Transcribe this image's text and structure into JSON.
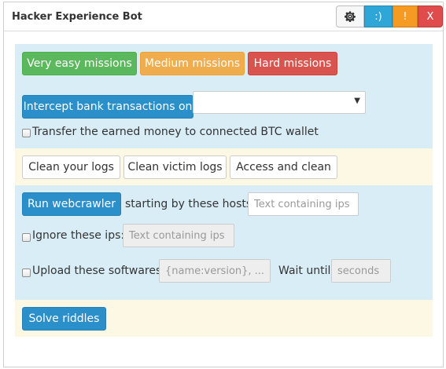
{
  "window": {
    "title": "Hacker Experience Bot"
  },
  "titlebar": {
    "gear_icon": "gear-icon",
    "smile_label": ":)",
    "warn_label": "!",
    "close_label": "X",
    "colors": {
      "smile": "#2ea7d8",
      "warn": "#f59a23",
      "close": "#e04c4c"
    }
  },
  "missions": {
    "very_easy": "Very easy missions",
    "medium": "Medium missions",
    "hard": "Hard missions"
  },
  "intercept": {
    "button": "Intercept bank transactions on",
    "select_value": "",
    "transfer_label": "Transfer the earned money to connected BTC wallet",
    "transfer_checked": false
  },
  "logs": {
    "clean_your_logs": "Clean your logs",
    "clean_victim_logs": "Clean victim logs",
    "access_and_clean": "Access and clean"
  },
  "crawler": {
    "run_button": "Run webcrawler",
    "starting_label": "starting by these hosts:",
    "hosts_placeholder": "Text containing ips",
    "ignore_label": "Ignore these ips:",
    "ignore_placeholder": "Text containing ips",
    "ignore_checked": false,
    "upload_label": "Upload these softwares:",
    "upload_placeholder": "{name:version}, ...",
    "upload_checked": false,
    "wait_label": "Wait until",
    "wait_placeholder": "seconds"
  },
  "riddles": {
    "solve_button": "Solve riddles"
  }
}
